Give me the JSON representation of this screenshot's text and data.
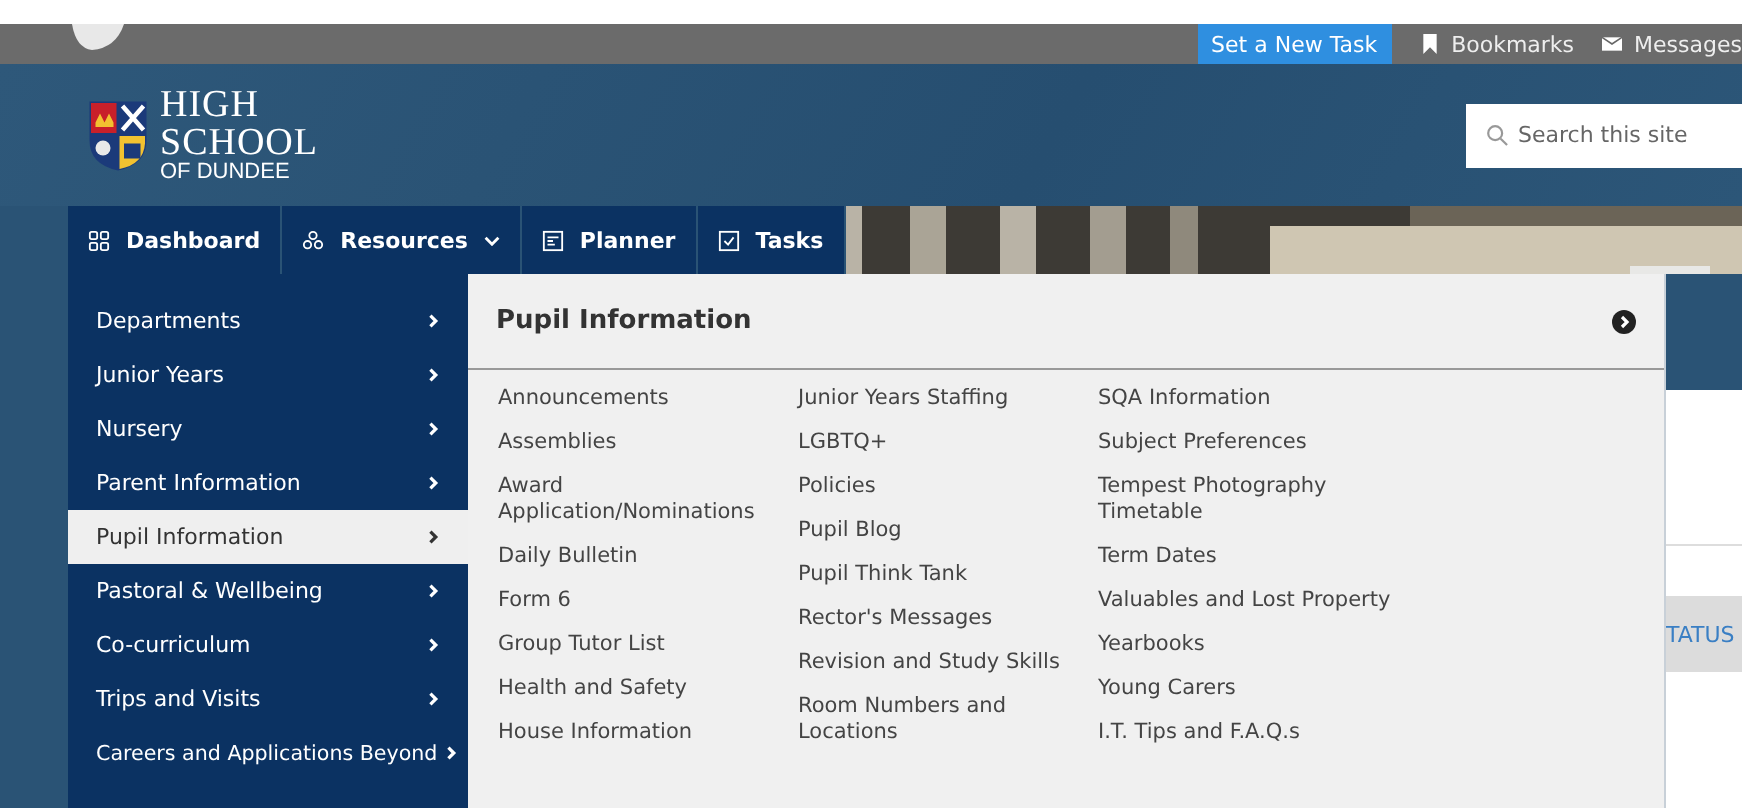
{
  "top_bar": {
    "new_task_button": "Set a New Task",
    "links": [
      {
        "label": "Bookmarks",
        "kind": "bookmark"
      },
      {
        "label": "Messages",
        "kind": "mail"
      }
    ]
  },
  "logo": {
    "line_1": "HIGH",
    "line_2": "SCHOOL",
    "line_3": "OF DUNDEE"
  },
  "search": {
    "placeholder": "Search this site"
  },
  "nav_tabs": [
    {
      "label": "Dashboard",
      "kind": "grid",
      "dropdown": false
    },
    {
      "label": "Resources",
      "kind": "people",
      "dropdown": true
    },
    {
      "label": "Planner",
      "kind": "planner",
      "dropdown": false
    },
    {
      "label": "Tasks",
      "kind": "check",
      "dropdown": false
    }
  ],
  "side_menu": [
    {
      "label": "Departments",
      "selected": false
    },
    {
      "label": "Junior Years",
      "selected": false
    },
    {
      "label": "Nursery",
      "selected": false
    },
    {
      "label": "Parent Information",
      "selected": false
    },
    {
      "label": "Pupil Information",
      "selected": true
    },
    {
      "label": "Pastoral & Wellbeing",
      "selected": false
    },
    {
      "label": "Co-curriculum",
      "selected": false
    },
    {
      "label": "Trips and Visits",
      "selected": false
    },
    {
      "label": "Careers and Applications Beyond",
      "selected": false
    }
  ],
  "panel": {
    "title": "Pupil Information",
    "columns": [
      [
        "Announcements",
        "Assemblies",
        "Award Application/Nominations",
        "Daily Bulletin",
        "Form 6",
        "Group Tutor List",
        "Health and Safety",
        "House Information"
      ],
      [
        "Junior Years Staffing",
        "LGBTQ+",
        "Policies",
        "Pupil Blog",
        "Pupil Think Tank",
        "Rector's Messages",
        "Revision and Study Skills",
        "Room Numbers and Locations"
      ],
      [
        "SQA Information",
        "Subject Preferences",
        "Tempest Photography Timetable",
        "Term Dates",
        "Valuables and Lost Property",
        "Yearbooks",
        "Young Carers",
        "I.T. Tips and F.A.Q.s"
      ]
    ]
  },
  "status_tab": "TATUS"
}
